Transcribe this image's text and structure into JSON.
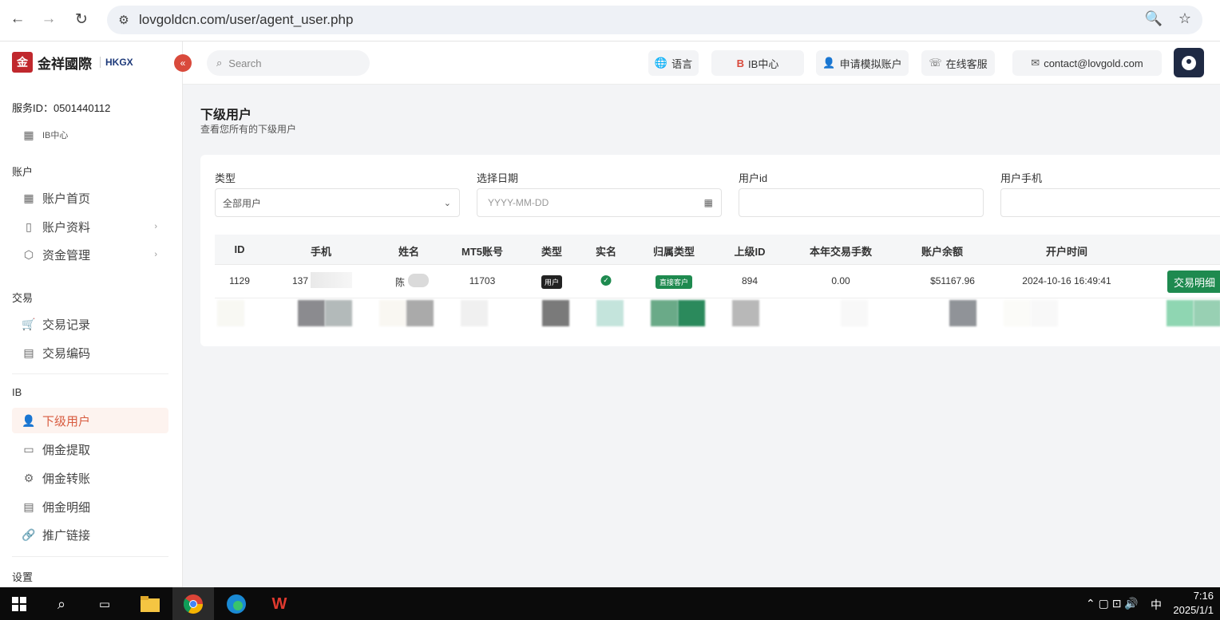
{
  "browser": {
    "url": "lovgoldcn.com/user/agent_user.php"
  },
  "logo": {
    "seal_text": "金",
    "brand": "金祥國際",
    "secondary": "HKGX"
  },
  "sidebar": {
    "service_id": "服务ID：0501440112",
    "ib_center": "IB中心",
    "sections": {
      "account": "账户",
      "trade": "交易",
      "ib": "IB",
      "settings": "设置"
    },
    "items": {
      "account_home": "账户首页",
      "account_info": "账户资料",
      "fund_mgmt": "资金管理",
      "trade_records": "交易记录",
      "trade_code": "交易编码",
      "sub_users": "下级用户",
      "commission_withdraw": "佣金提取",
      "commission_transfer": "佣金转账",
      "commission_detail": "佣金明细",
      "promo_link": "推广链接"
    }
  },
  "topbar": {
    "search_placeholder": "Search",
    "language": "语言",
    "ib_center": "IB中心",
    "demo_account": "申请模拟账户",
    "online_service": "在线客服",
    "email": "contact@lovgold.com"
  },
  "page": {
    "title": "下级用户",
    "subtitle": "查看您所有的下级用户"
  },
  "filters": {
    "type_label": "类型",
    "type_value": "全部用户",
    "date_label": "选择日期",
    "date_placeholder": "YYYY-MM-DD",
    "userid_label": "用户id",
    "userid_value": "",
    "phone_label": "用户手机",
    "phone_value": ""
  },
  "table": {
    "headers": [
      "ID",
      "手机",
      "姓名",
      "MT5账号",
      "类型",
      "实名",
      "归属类型",
      "上级ID",
      "本年交易手数",
      "账户余额",
      "开户时间"
    ],
    "rows": [
      {
        "id": "1129",
        "phone": "137",
        "name": "陈",
        "mt5": "11703",
        "type": "用户",
        "verified": "✓",
        "belong": "直接客户",
        "parent_id": "894",
        "lots": "0.00",
        "balance": "$51167.96",
        "opened": "2024-10-16 16:49:41",
        "action": "交易明细"
      }
    ]
  },
  "taskbar": {
    "ime": "中",
    "time": "7:16",
    "date": "2025/1/1"
  },
  "colors": {
    "accent_red": "#d94a3c",
    "green": "#1e8a4f",
    "active_bg": "#fdf3ef"
  }
}
